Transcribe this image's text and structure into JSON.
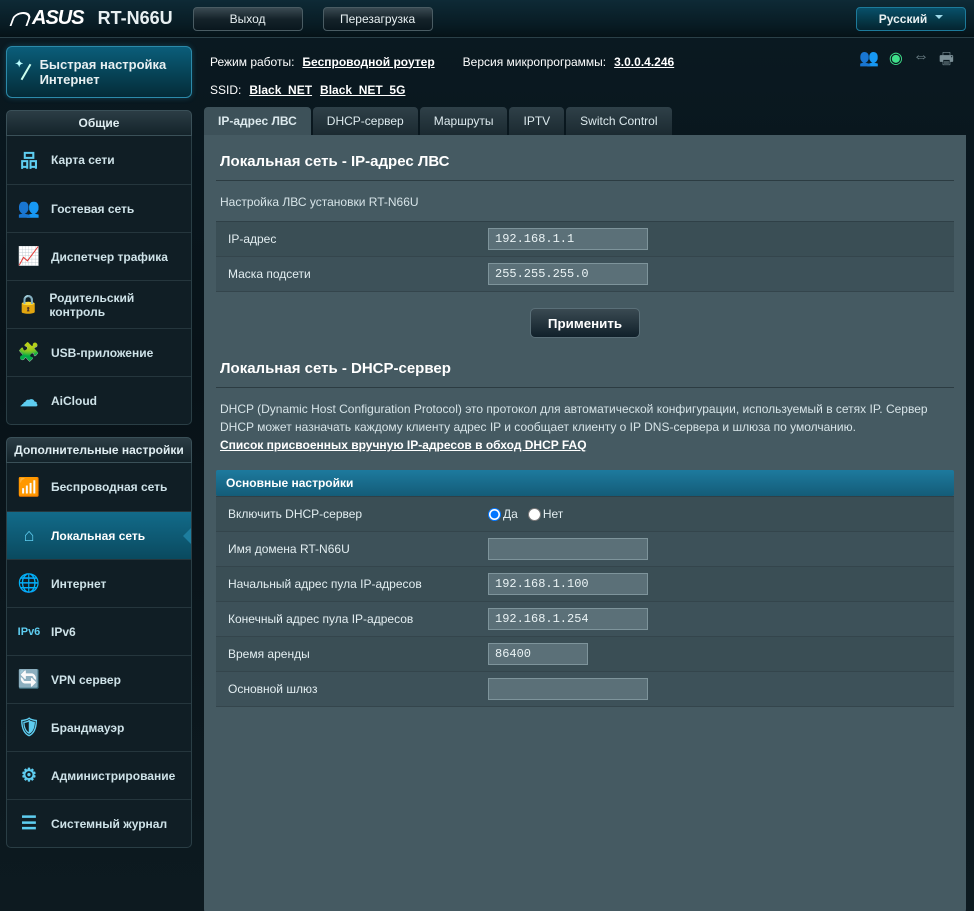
{
  "header": {
    "brand": "ASUS",
    "model": "RT-N66U",
    "logout": "Выход",
    "reboot": "Перезагрузка",
    "language": "Русский"
  },
  "info": {
    "mode_label": "Режим работы:",
    "mode_value": "Беспроводной роутер",
    "fw_label": "Версия микропрограммы:",
    "fw_value": "3.0.0.4.246",
    "ssid_label": "SSID:",
    "ssid_1": "Black_NET",
    "ssid_2": "Black_NET_5G"
  },
  "sidebar": {
    "qis": "Быстрая настройка Интернет",
    "section_general": "Общие",
    "section_advanced": "Дополнительные настройки",
    "general": [
      "Карта сети",
      "Гостевая сеть",
      "Диспетчер трафика",
      "Родительский контроль",
      "USB-приложение",
      "AiCloud"
    ],
    "advanced": [
      "Беспроводная сеть",
      "Локальная сеть",
      "Интернет",
      "IPv6",
      "VPN сервер",
      "Брандмауэр",
      "Администри­рование",
      "Системный журнал"
    ]
  },
  "tabs": [
    "IP-адрес ЛВС",
    "DHCP-сервер",
    "Маршруты",
    "IPTV",
    "Switch Control"
  ],
  "lan_ip": {
    "title": "Локальная сеть - IP-адрес ЛВС",
    "desc": "Настройка ЛВС установки RT-N66U",
    "ip_label": "IP-адрес",
    "ip_value": "192.168.1.1",
    "mask_label": "Маска подсети",
    "mask_value": "255.255.255.0",
    "apply": "Применить"
  },
  "dhcp": {
    "title": "Локальная сеть - DHCP-сервер",
    "desc": "DHCP (Dynamic Host Configuration Protocol) это протокол для автоматической конфигурации, используемый в сетях IP. Сервер DHCP может назначать каждому клиенту адрес IP и сообщает клиенту о IP DNS-сервера и шлюза по умолчанию.",
    "faq_link": "Список присвоенных вручную IP-адресов в обход DHCP FAQ",
    "subheader": "Основные настройки",
    "enable_label": "Включить DHCP-сервер",
    "yes": "Да",
    "no": "Нет",
    "domain_label": "Имя домена RT-N66U",
    "domain_value": "",
    "pool_start_label": "Начальный адрес пула IP-адресов",
    "pool_start_value": "192.168.1.100",
    "pool_end_label": "Конечный адрес пула IP-адресов",
    "pool_end_value": "192.168.1.254",
    "lease_label": "Время аренды",
    "lease_value": "86400",
    "gateway_label": "Основной шлюз",
    "gateway_value": ""
  }
}
